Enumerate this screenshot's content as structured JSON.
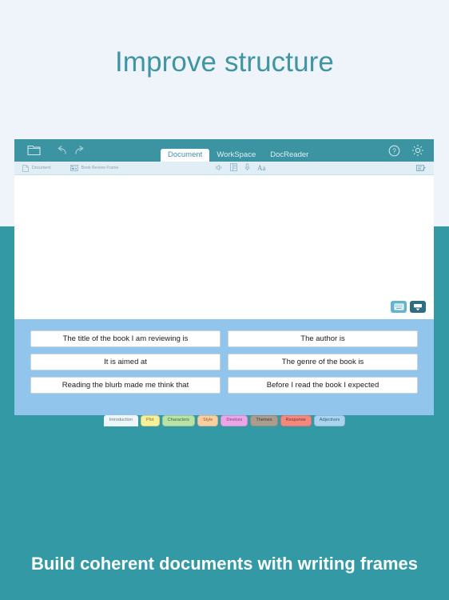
{
  "headline": "Improve structure",
  "footer_caption": "Build coherent documents with writing frames",
  "colors": {
    "page_top_bg": "#eef4fa",
    "page_bottom_bg": "#339aa5",
    "headline_text": "#4095a3",
    "toolbar_teal": "#3c93a2",
    "sub_toolbar_bg": "#e2eef5",
    "frame_panel_bg": "#92c5ec"
  },
  "app": {
    "toolbar": {
      "folder_icon": "folder-icon",
      "undo_icon": "undo-icon",
      "redo_icon": "redo-icon",
      "help_icon": "help-circle-icon",
      "settings_icon": "gear-icon",
      "tabs": [
        {
          "label": "Document",
          "active": true
        },
        {
          "label": "WorkSpace",
          "active": false
        },
        {
          "label": "DocReader",
          "active": false
        }
      ]
    },
    "sub_toolbar": {
      "document_label": "Document",
      "frame_label": "Book Review Frame",
      "document_icon": "document-icon",
      "frame_icon": "frame-grid-icon",
      "speaker_icon": "speaker-icon",
      "layout_icon": "page-layout-icon",
      "microphone_icon": "microphone-icon",
      "text_format_label": "Aa",
      "annotate_icon": "annotate-icon"
    },
    "canvas": {
      "show_keyboard_icon": "keyboard-icon",
      "hide_keyboard_icon": "hide-keyboard-icon"
    },
    "writing_frame": {
      "prompts": [
        "The title of the book I am reviewing is",
        "The author is",
        "It is aimed at",
        "The genre of the book is",
        "Reading the blurb made me think that",
        "Before I read the book I expected"
      ]
    },
    "category_tabs": [
      {
        "label": "Introduction",
        "bg": "#f0f5f8",
        "text": "#5d7f92",
        "active": true
      },
      {
        "label": "Plot",
        "bg": "#f7f09a",
        "text": "#7d7630",
        "active": false
      },
      {
        "label": "Characters",
        "bg": "#b7e2a8",
        "text": "#3f6b36",
        "active": false
      },
      {
        "label": "Style",
        "bg": "#f9cf9f",
        "text": "#8a6130",
        "active": false
      },
      {
        "label": "Devices",
        "bg": "#eba6e8",
        "text": "#7b3b78",
        "active": false
      },
      {
        "label": "Themes",
        "bg": "#a99d8f",
        "text": "#3e3730",
        "active": false
      },
      {
        "label": "Response",
        "bg": "#f3887f",
        "text": "#7d2e27",
        "active": false
      },
      {
        "label": "Adjectives",
        "bg": "#a9d3ef",
        "text": "#2f5f80",
        "active": false
      }
    ]
  }
}
